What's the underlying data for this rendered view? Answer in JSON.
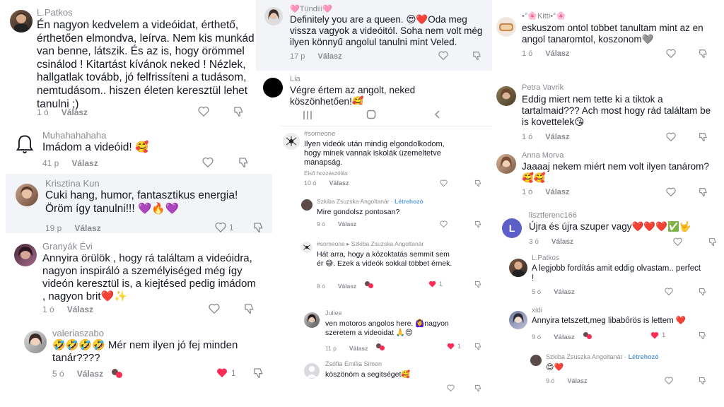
{
  "col1": [
    {
      "user": "L.Patkos",
      "text": "Én nagyon kedvelem a videóidat, érthető, érthetően elmondva, leírva. Nem kis munkád van benne, látszik. És az is, hogy örömmel csinálod ! Kitartást kívánok neked ! Nézlek, hallgatlak tovább, jó felfrissíteni a tudásom, nemtudásom.. hiszen életen keresztül lehet tanulni ;)",
      "time": "1 ó",
      "reply": "Válasz"
    },
    {
      "user": "Muhahahahaha",
      "text": "Imádom a videóid! 🥰",
      "time": "41 p",
      "reply": "Válasz"
    },
    {
      "user": "Krisztina Kun",
      "text": "Cuki hang, humor, fantasztikus energia! Öröm így tanulni!!! 💜🔥💜",
      "time": "19 p",
      "reply": "Válasz",
      "likes": "1"
    },
    {
      "user": "Granyák Évi",
      "text": "Annyira örülök , hogy rá találtam a videóidra, nagyon inspiráló a személyiséged még így videón keresztül is, a kiejtésed pedig imádom , nagyon brit❤️✨",
      "time": "1 ó",
      "reply": "Válasz"
    },
    {
      "user": "valeriaszabo",
      "text": "🤣🤣🤣🤣 Mér nem ilyen jó fej minden tanár????",
      "time": "5 ó",
      "reply": "Válasz",
      "likes": "1"
    }
  ],
  "col2_top": [
    {
      "user": "🩷Tündiii🩷",
      "text": "Definitely you are a queen. 😍❤️Oda meg vissza vagyok a videóitól. Soha nem volt még ilyen könnyű angolul tanulni mint Veled.",
      "time": "17 p",
      "reply": "Válasz"
    },
    {
      "user": "Lia",
      "text": "Végre értem az angolt, neked köszönhetően!🥰"
    }
  ],
  "col2_bottom": [
    {
      "user": "#someone",
      "text": "Ilyen videók után mindig elgondolkodom, hogy minek vannak iskolák üzemeltetve manapság.",
      "sub": "Első hozzászólás",
      "time": "10 ó",
      "reply": "Válasz"
    },
    {
      "user": "Szkiba Zsuzska Angoltanár",
      "creator": "Létrehozó",
      "text": "Mire gondolsz pontosan?",
      "time": "9 ó",
      "reply": "Válasz"
    },
    {
      "user": "#someone",
      "arrow": "▸",
      "to": "Szkiba Zsuzska Angoltanár",
      "text": "Hát arra, hogy a közoktatás semmit sem ér 😅. Ezek a videók sokkal többet érnek.",
      "time": "8 ó",
      "reply": "Válasz",
      "likes": "1"
    },
    {
      "user": "Juliee",
      "text": "ven motoros angolos here. 🙆‍♀️nagyon szeretem a videoidat 🙏😍",
      "time": "11 p",
      "reply": "Válasz",
      "likes": "1"
    },
    {
      "user": "Zsófia Emília Simon",
      "text": "köszönöm a segitséget🥰",
      "time": "",
      "reply": ""
    }
  ],
  "col3": [
    {
      "user": "•°🌸Kitti•°🌸",
      "text": "eskuszom ontol tobbet tanultam mint az en angol tanaromtol, koszonom🩶",
      "time": "1 ó",
      "reply": "Válasz"
    },
    {
      "user": "Petra Vavrik",
      "text": "Eddig miert nem tette ki a tiktok a tartalmaid??? Ach most hogy rád találtam be is kovettelek😘",
      "time": "1 ó",
      "reply": "Válasz"
    },
    {
      "user": "Anna Morva",
      "text": "Jaaaaj nekem miért nem volt ilyen tanárom? 🥰🥰",
      "time": "1 ó",
      "reply": "Válasz"
    },
    {
      "user": "lisztferenc166",
      "avatar_letter": "L",
      "text": "Újra és újra szuper vagy❤️❤️❤️✅🤟",
      "time": "3 ó",
      "reply": "Válasz"
    },
    {
      "user": "L.Patkos",
      "text": "A legjobb fordítás amit eddig olvastam.. perfect !",
      "time": "5 ó",
      "reply": "Válasz"
    },
    {
      "user": "xidi",
      "text": "Annyira tetszett,meg libabőrös is lettem ❤️",
      "time": "9 ó",
      "reply": "Válasz",
      "likes": "1"
    },
    {
      "user": "Szkiba Zsuszka Angoltanár",
      "creator": "Létrehozó",
      "text": "😍❤️",
      "time": "9 ó",
      "reply": "Válasz"
    }
  ],
  "colors": {
    "heart": "#fe2c55",
    "muted": "#8a8b91",
    "creator": "#5b9bd5",
    "purple_avatar": "#5b5fc7"
  },
  "nav": {
    "menu_icon": "menu-icon",
    "home_icon": "home-icon",
    "back_icon": "back-icon"
  }
}
